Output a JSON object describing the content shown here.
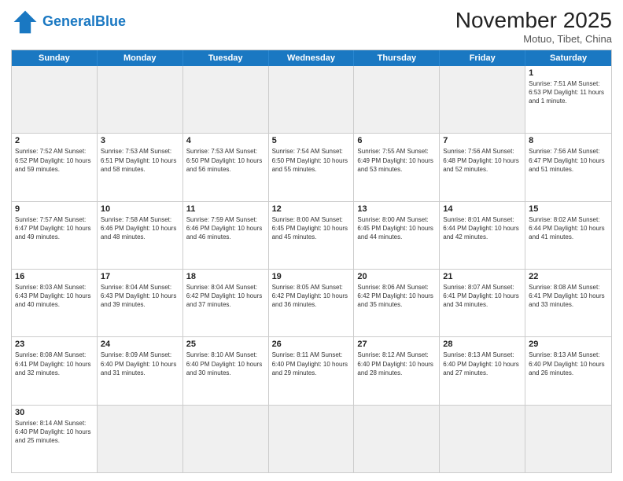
{
  "header": {
    "logo_general": "General",
    "logo_blue": "Blue",
    "month_title": "November 2025",
    "subtitle": "Motuo, Tibet, China"
  },
  "days_of_week": [
    "Sunday",
    "Monday",
    "Tuesday",
    "Wednesday",
    "Thursday",
    "Friday",
    "Saturday"
  ],
  "weeks": [
    [
      {
        "day": "",
        "empty": true,
        "info": ""
      },
      {
        "day": "",
        "empty": true,
        "info": ""
      },
      {
        "day": "",
        "empty": true,
        "info": ""
      },
      {
        "day": "",
        "empty": true,
        "info": ""
      },
      {
        "day": "",
        "empty": true,
        "info": ""
      },
      {
        "day": "",
        "empty": true,
        "info": ""
      },
      {
        "day": "1",
        "empty": false,
        "info": "Sunrise: 7:51 AM\nSunset: 6:53 PM\nDaylight: 11 hours\nand 1 minute."
      }
    ],
    [
      {
        "day": "2",
        "empty": false,
        "info": "Sunrise: 7:52 AM\nSunset: 6:52 PM\nDaylight: 10 hours\nand 59 minutes."
      },
      {
        "day": "3",
        "empty": false,
        "info": "Sunrise: 7:53 AM\nSunset: 6:51 PM\nDaylight: 10 hours\nand 58 minutes."
      },
      {
        "day": "4",
        "empty": false,
        "info": "Sunrise: 7:53 AM\nSunset: 6:50 PM\nDaylight: 10 hours\nand 56 minutes."
      },
      {
        "day": "5",
        "empty": false,
        "info": "Sunrise: 7:54 AM\nSunset: 6:50 PM\nDaylight: 10 hours\nand 55 minutes."
      },
      {
        "day": "6",
        "empty": false,
        "info": "Sunrise: 7:55 AM\nSunset: 6:49 PM\nDaylight: 10 hours\nand 53 minutes."
      },
      {
        "day": "7",
        "empty": false,
        "info": "Sunrise: 7:56 AM\nSunset: 6:48 PM\nDaylight: 10 hours\nand 52 minutes."
      },
      {
        "day": "8",
        "empty": false,
        "info": "Sunrise: 7:56 AM\nSunset: 6:47 PM\nDaylight: 10 hours\nand 51 minutes."
      }
    ],
    [
      {
        "day": "9",
        "empty": false,
        "info": "Sunrise: 7:57 AM\nSunset: 6:47 PM\nDaylight: 10 hours\nand 49 minutes."
      },
      {
        "day": "10",
        "empty": false,
        "info": "Sunrise: 7:58 AM\nSunset: 6:46 PM\nDaylight: 10 hours\nand 48 minutes."
      },
      {
        "day": "11",
        "empty": false,
        "info": "Sunrise: 7:59 AM\nSunset: 6:46 PM\nDaylight: 10 hours\nand 46 minutes."
      },
      {
        "day": "12",
        "empty": false,
        "info": "Sunrise: 8:00 AM\nSunset: 6:45 PM\nDaylight: 10 hours\nand 45 minutes."
      },
      {
        "day": "13",
        "empty": false,
        "info": "Sunrise: 8:00 AM\nSunset: 6:45 PM\nDaylight: 10 hours\nand 44 minutes."
      },
      {
        "day": "14",
        "empty": false,
        "info": "Sunrise: 8:01 AM\nSunset: 6:44 PM\nDaylight: 10 hours\nand 42 minutes."
      },
      {
        "day": "15",
        "empty": false,
        "info": "Sunrise: 8:02 AM\nSunset: 6:44 PM\nDaylight: 10 hours\nand 41 minutes."
      }
    ],
    [
      {
        "day": "16",
        "empty": false,
        "info": "Sunrise: 8:03 AM\nSunset: 6:43 PM\nDaylight: 10 hours\nand 40 minutes."
      },
      {
        "day": "17",
        "empty": false,
        "info": "Sunrise: 8:04 AM\nSunset: 6:43 PM\nDaylight: 10 hours\nand 39 minutes."
      },
      {
        "day": "18",
        "empty": false,
        "info": "Sunrise: 8:04 AM\nSunset: 6:42 PM\nDaylight: 10 hours\nand 37 minutes."
      },
      {
        "day": "19",
        "empty": false,
        "info": "Sunrise: 8:05 AM\nSunset: 6:42 PM\nDaylight: 10 hours\nand 36 minutes."
      },
      {
        "day": "20",
        "empty": false,
        "info": "Sunrise: 8:06 AM\nSunset: 6:42 PM\nDaylight: 10 hours\nand 35 minutes."
      },
      {
        "day": "21",
        "empty": false,
        "info": "Sunrise: 8:07 AM\nSunset: 6:41 PM\nDaylight: 10 hours\nand 34 minutes."
      },
      {
        "day": "22",
        "empty": false,
        "info": "Sunrise: 8:08 AM\nSunset: 6:41 PM\nDaylight: 10 hours\nand 33 minutes."
      }
    ],
    [
      {
        "day": "23",
        "empty": false,
        "info": "Sunrise: 8:08 AM\nSunset: 6:41 PM\nDaylight: 10 hours\nand 32 minutes."
      },
      {
        "day": "24",
        "empty": false,
        "info": "Sunrise: 8:09 AM\nSunset: 6:40 PM\nDaylight: 10 hours\nand 31 minutes."
      },
      {
        "day": "25",
        "empty": false,
        "info": "Sunrise: 8:10 AM\nSunset: 6:40 PM\nDaylight: 10 hours\nand 30 minutes."
      },
      {
        "day": "26",
        "empty": false,
        "info": "Sunrise: 8:11 AM\nSunset: 6:40 PM\nDaylight: 10 hours\nand 29 minutes."
      },
      {
        "day": "27",
        "empty": false,
        "info": "Sunrise: 8:12 AM\nSunset: 6:40 PM\nDaylight: 10 hours\nand 28 minutes."
      },
      {
        "day": "28",
        "empty": false,
        "info": "Sunrise: 8:13 AM\nSunset: 6:40 PM\nDaylight: 10 hours\nand 27 minutes."
      },
      {
        "day": "29",
        "empty": false,
        "info": "Sunrise: 8:13 AM\nSunset: 6:40 PM\nDaylight: 10 hours\nand 26 minutes."
      }
    ],
    [
      {
        "day": "30",
        "empty": false,
        "info": "Sunrise: 8:14 AM\nSunset: 6:40 PM\nDaylight: 10 hours\nand 25 minutes."
      },
      {
        "day": "",
        "empty": true,
        "info": ""
      },
      {
        "day": "",
        "empty": true,
        "info": ""
      },
      {
        "day": "",
        "empty": true,
        "info": ""
      },
      {
        "day": "",
        "empty": true,
        "info": ""
      },
      {
        "day": "",
        "empty": true,
        "info": ""
      },
      {
        "day": "",
        "empty": true,
        "info": ""
      }
    ]
  ]
}
